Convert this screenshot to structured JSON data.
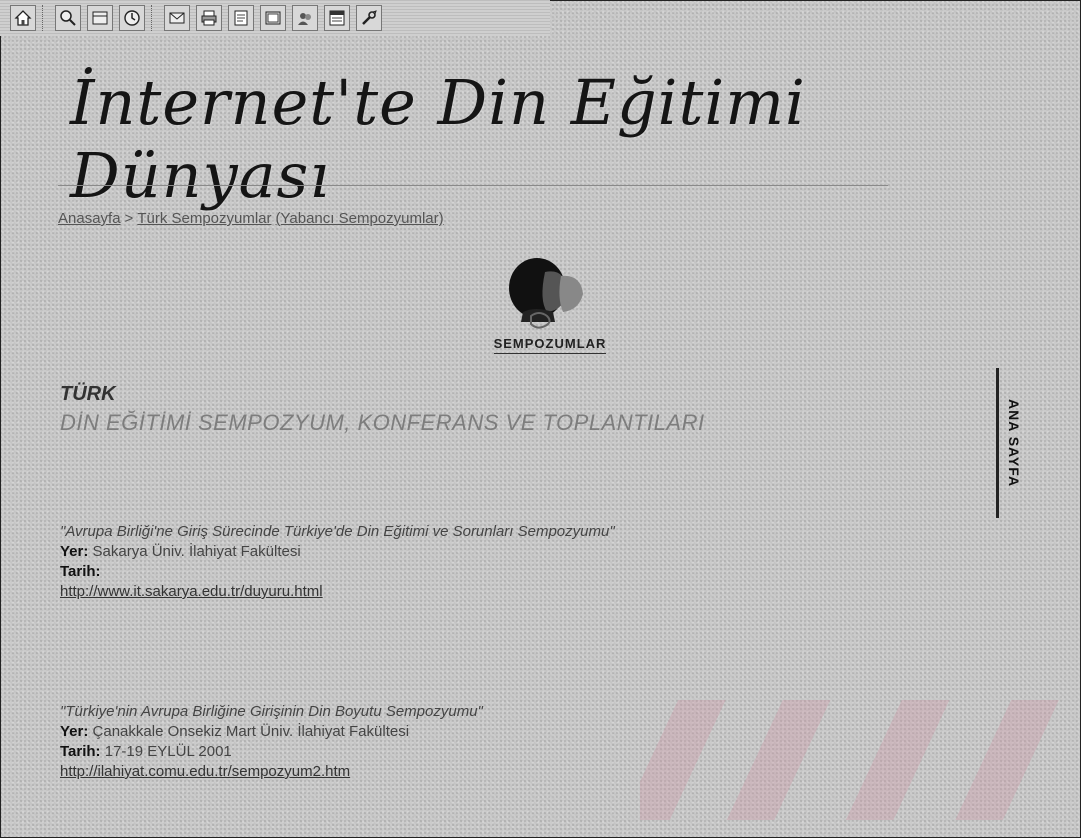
{
  "page": {
    "title": "İnternet'te Din Eğitimi Dünyası",
    "breadcrumb": {
      "home": "Anasayfa",
      "sep1": ">",
      "current": "Türk Sempozyumlar",
      "other": "(Yabancı Sempozyumlar)"
    },
    "logo": {
      "caption": "SEMPOZUMLAR"
    },
    "heading": {
      "line1": "TÜRK",
      "line2": "DİN EĞİTİMİ SEMPOZYUM, KONFERANS VE TOPLANTILARI"
    },
    "side_nav": {
      "label": "ANA SAYFA"
    },
    "entries": [
      {
        "title": "\"Avrupa Birliği'ne Giriş Sürecinde Türkiye'de Din Eğitimi ve Sorunları Sempozyumu\"",
        "place_label": "Yer:",
        "place": "Sakarya Üniv. İlahiyat Fakültesi",
        "date_label": "Tarih:",
        "date": "",
        "link": "http://www.it.sakarya.edu.tr/duyuru.html"
      },
      {
        "title": "\"Türkiye'nin Avrupa Birliğine Girişinin Din Boyutu Sempozyumu\"",
        "place_label": "Yer:",
        "place": "Çanakkale Onsekiz Mart Üniv. İlahiyat Fakültesi",
        "date_label": "Tarih:",
        "date": "17-19 EYLÜL 2001",
        "link": "http://ilahiyat.comu.edu.tr/sempozyum2.htm"
      }
    ]
  },
  "toolbar": {
    "icons": [
      "home-icon",
      "search-icon",
      "favorites-icon",
      "history-icon",
      "mail-icon",
      "print-icon",
      "edit-icon",
      "discuss-icon",
      "messenger-icon",
      "page-icon",
      "tools-icon"
    ]
  }
}
